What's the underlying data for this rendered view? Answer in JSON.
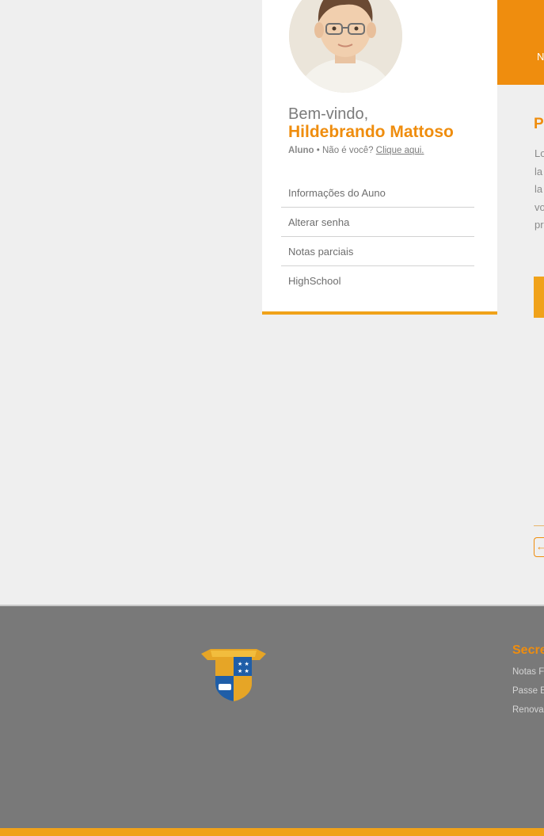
{
  "profile": {
    "welcome": "Bem-vindo,",
    "name": "Hildebrando Mattoso",
    "role": "Aluno",
    "separator": " • ",
    "not_you": "Não é você? ",
    "click_here": "Clique aqui."
  },
  "menu": {
    "items": [
      {
        "label": "Informações do Auno"
      },
      {
        "label": "Alterar senha"
      },
      {
        "label": "Notas parciais"
      },
      {
        "label": "HighSchool"
      }
    ]
  },
  "right_panel": {
    "header_fragment": "N",
    "title_fragment": "P",
    "paragraph_fragments": [
      "Lo",
      "la",
      "la",
      "vo",
      "pr"
    ],
    "back_icon": "arrow-left-icon"
  },
  "footer": {
    "heading": "Secre",
    "links": [
      "Notas F",
      "Passe E",
      "Renova"
    ],
    "logo_icon": "school-crest-icon"
  },
  "colors": {
    "accent": "#ef8d0e",
    "accent_light": "#f0a21a",
    "footer_bg": "#797979",
    "page_bg": "#efefef"
  }
}
